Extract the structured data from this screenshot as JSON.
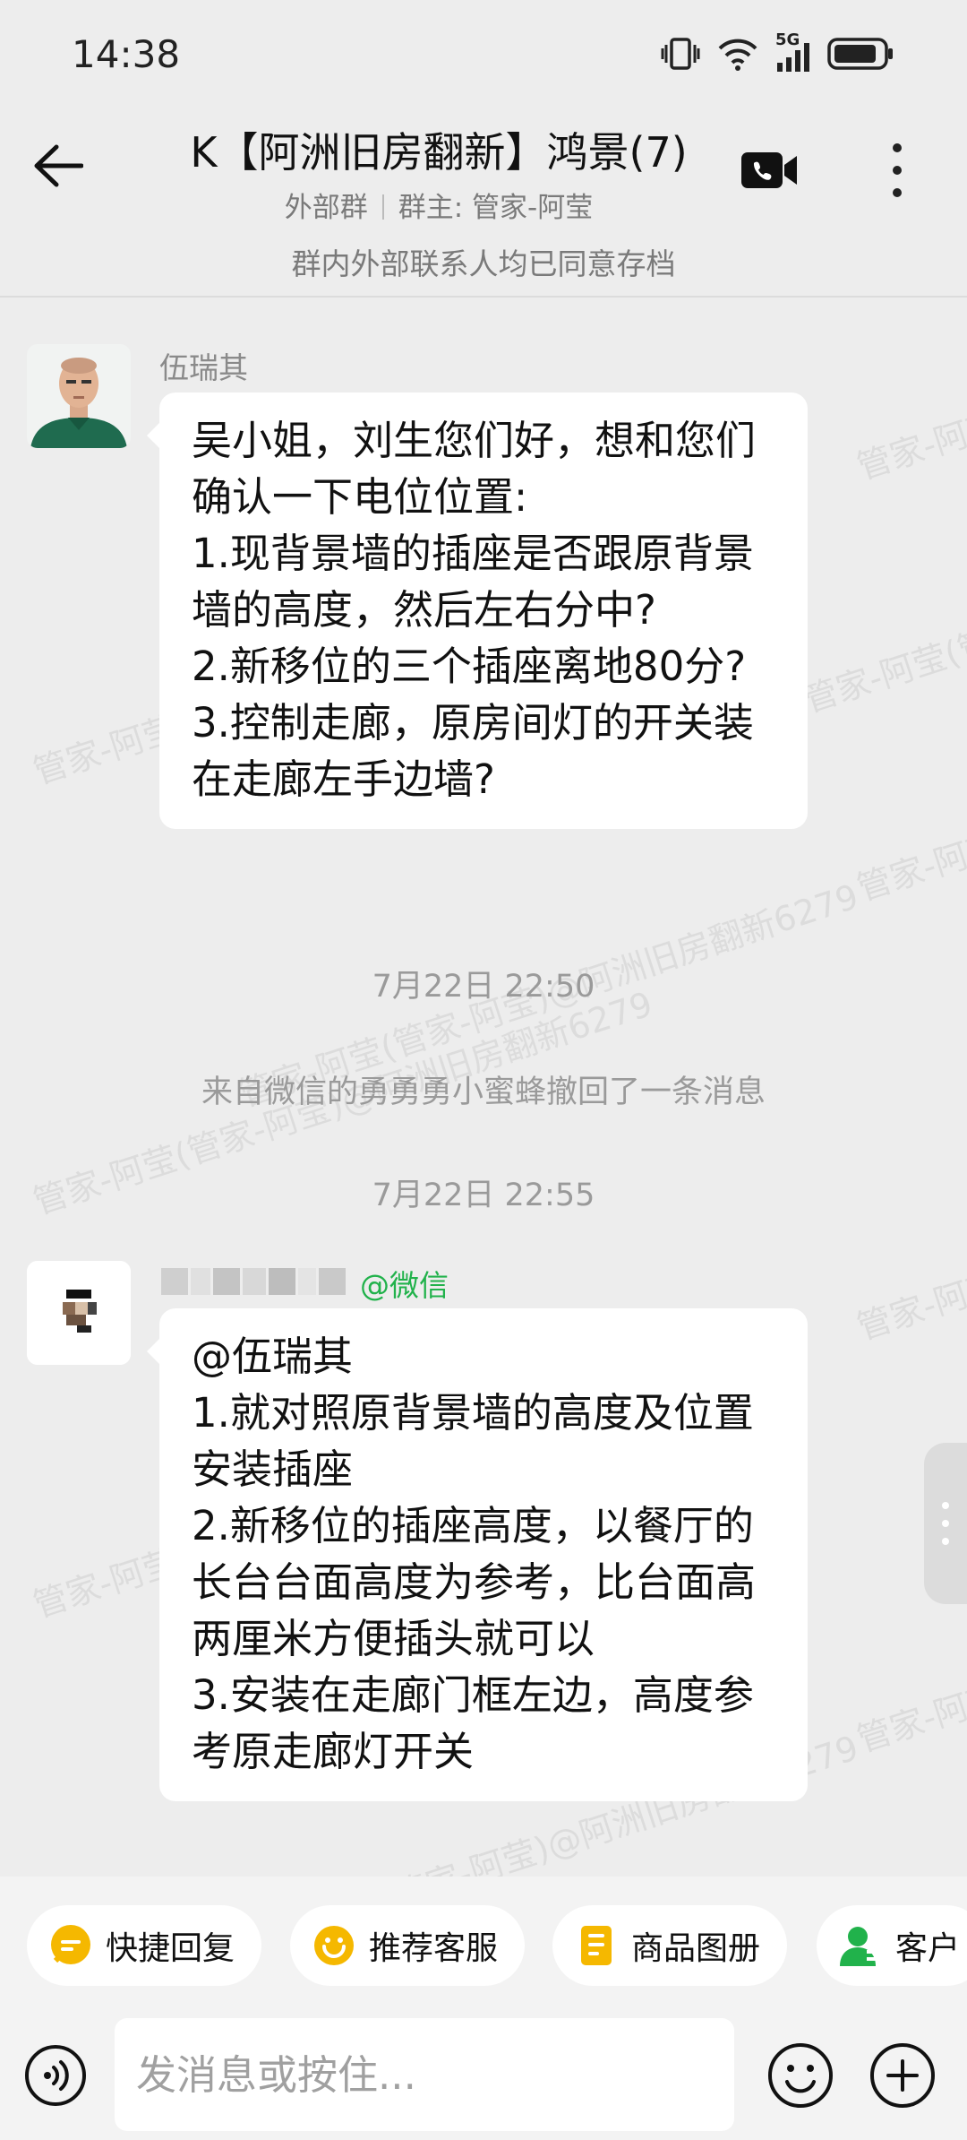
{
  "status_bar": {
    "time": "14:38",
    "network": "5G"
  },
  "header": {
    "title": "K【阿洲旧房翻新】鸿景(7)",
    "group_type": "外部群",
    "owner": "群主: 管家-阿莹"
  },
  "archive_notice": "群内外部联系人均已同意存档",
  "watermark": [
    "管家-阿莹(管家-阿莹)@阿洲旧房翻新6279"
  ],
  "messages": [
    {
      "sender": "伍瑞其",
      "text": "吴小姐，刘生您们好，想和您们确认一下电位位置:\n1.现背景墙的插座是否跟原背景墙的高度，然后左右分中?\n2.新移位的三个插座离地80分?\n3.控制走廊，原房间灯的开关装在走廊左手边墙?"
    },
    {
      "sender_tag": "@微信",
      "text": "@伍瑞其\n1.就对照原背景墙的高度及位置安装插座\n2.新移位的插座高度，以餐厅的长台台面高度为参考，比台面高两厘米方便插头就可以\n3.安装在走廊门框左边，高度参考原走廊灯开关"
    }
  ],
  "timestamps": [
    "7月22日  22:50",
    "7月22日  22:55"
  ],
  "system_message": "来自微信的勇勇勇小蜜蜂撤回了一条消息",
  "quick_actions": [
    {
      "label": "快捷回复",
      "icon": "chat-bubble-icon",
      "color": "#f5b800"
    },
    {
      "label": "推荐客服",
      "icon": "service-icon",
      "color": "#f5b800"
    },
    {
      "label": "商品图册",
      "icon": "catalog-icon",
      "color": "#f5b800"
    },
    {
      "label": "客户",
      "icon": "customer-icon",
      "color": "#21b24b"
    }
  ],
  "composer": {
    "placeholder": "发消息或按住..."
  },
  "colors": {
    "accent_green": "#21b24b",
    "bubble": "#ffffff",
    "background": "#ededed"
  }
}
